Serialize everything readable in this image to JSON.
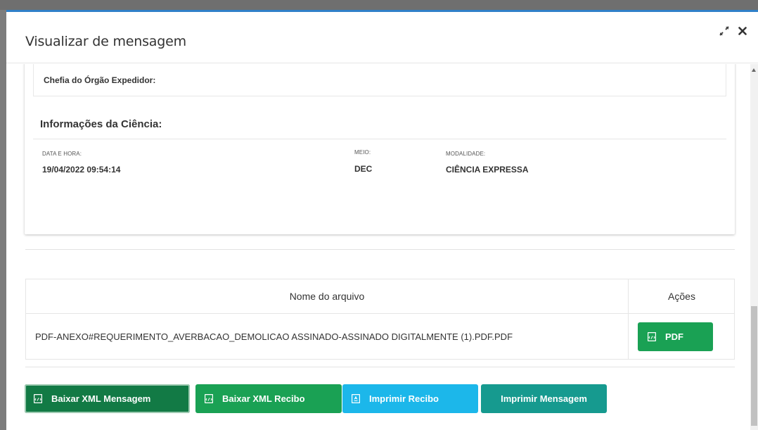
{
  "modal": {
    "title": "Visualizar de mensagem"
  },
  "chefia": {
    "label": "Chefia do Órgão Expedidor:"
  },
  "ciencia": {
    "title": "Informações da Ciência:",
    "fields": [
      {
        "label": "DATA E HORA:",
        "value": "19/04/2022 09:54:14"
      },
      {
        "label": "MEIO:",
        "value": "DEC"
      },
      {
        "label": "MODALIDADE:",
        "value": "CIÊNCIA EXPRESSA"
      }
    ]
  },
  "files_table": {
    "headers": [
      "Nome do arquivo",
      "Ações"
    ],
    "rows": [
      {
        "name": "PDF-ANEXO#REQUERIMENTO_AVERBACAO_DEMOLICAO ASSINADO-ASSINADO DIGITALMENTE (1).PDF.PDF",
        "action_label": "PDF"
      }
    ]
  },
  "footer_buttons": {
    "baixar_xml_mensagem": "Baixar XML Mensagem",
    "baixar_xml_recibo": "Baixar XML Recibo",
    "imprimir_recibo": "Imprimir Recibo",
    "imprimir_mensagem": "Imprimir Mensagem"
  },
  "colors": {
    "header_accent": "#2f80c9",
    "green_dark": "#127a45",
    "green": "#1aa154",
    "cyan": "#1cb7ea",
    "teal": "#169a8f"
  },
  "icons": [
    "expand-icon",
    "close-icon",
    "file-code-icon",
    "file-pdf-icon"
  ]
}
